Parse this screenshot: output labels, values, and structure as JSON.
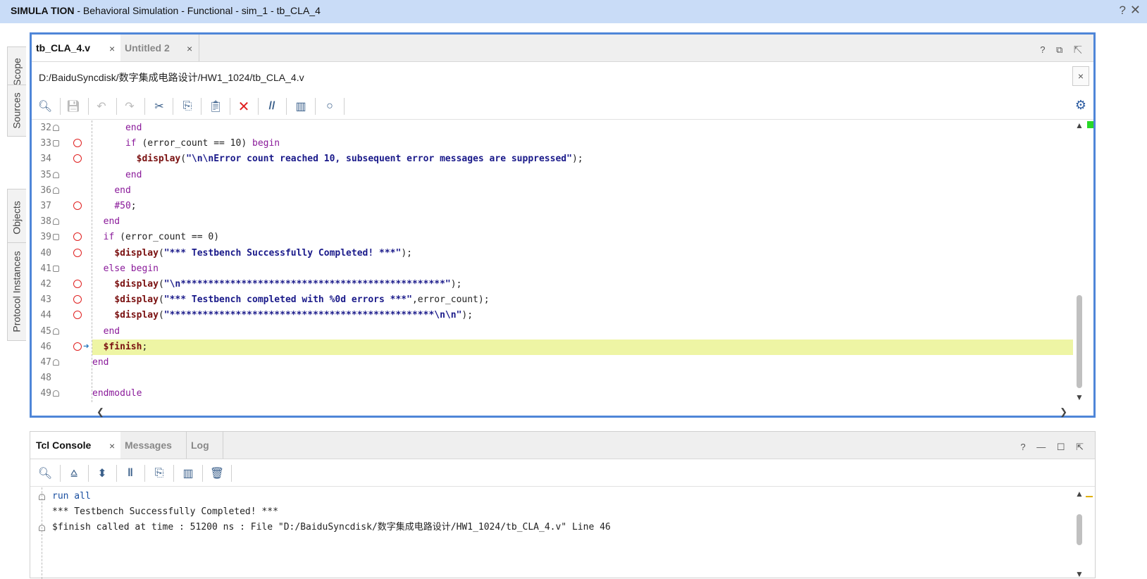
{
  "window": {
    "title_bold": "SIMULA TION",
    "title_rest": " - Behavioral Simulation - Functional - sim_1 - tb_CLA_4",
    "help": "?",
    "close": "✕"
  },
  "side_tabs": [
    "Scope",
    "Sources",
    "Objects",
    "Protocol Instances"
  ],
  "editor": {
    "tabs": [
      {
        "label": "tb_CLA_4.v",
        "close": "×",
        "active": true
      },
      {
        "label": "Untitled 2",
        "close": "×",
        "active": false
      }
    ],
    "window_icons": "? ⧉ ⇱",
    "path": "D:/BaiduSyncdisk/数字集成电路设计/HW1_1024/tb_CLA_4.v",
    "path_close": "×",
    "toolbar_icons": [
      "search-icon",
      "save-icon",
      "undo-icon",
      "redo-icon",
      "cut-icon",
      "copy-icon",
      "paste-icon",
      "delete-icon",
      "comment-icon",
      "columns-icon",
      "bulb-icon"
    ],
    "settings_icon": "gear-icon",
    "lines": [
      {
        "n": "32",
        "fold": "end",
        "bp": false,
        "text_html": "      <span class='kw'>end</span>"
      },
      {
        "n": "33",
        "fold": "start",
        "bp": true,
        "text_html": "      <span class='kw'>if</span> (error_count == 10) <span class='kw'>begin</span>"
      },
      {
        "n": "34",
        "fold": "",
        "bp": true,
        "text_html": "        <span class='sys'>$display</span>(<span class='str'>\"\\n\\nError count reached 10, subsequent error messages are suppressed\"</span>);"
      },
      {
        "n": "35",
        "fold": "end",
        "bp": false,
        "text_html": "      <span class='kw'>end</span>"
      },
      {
        "n": "36",
        "fold": "end",
        "bp": false,
        "text_html": "    <span class='kw'>end</span>"
      },
      {
        "n": "37",
        "fold": "",
        "bp": true,
        "text_html": "    <span class='kw'>#50</span>;"
      },
      {
        "n": "38",
        "fold": "end",
        "bp": false,
        "text_html": "  <span class='kw'>end</span>"
      },
      {
        "n": "39",
        "fold": "start",
        "bp": true,
        "text_html": "  <span class='kw'>if</span> (error_count == 0)"
      },
      {
        "n": "40",
        "fold": "",
        "bp": true,
        "text_html": "    <span class='sys'>$display</span>(<span class='str'>\"*** Testbench Successfully Completed! ***\"</span>);"
      },
      {
        "n": "41",
        "fold": "start",
        "bp": false,
        "text_html": "  <span class='kw'>else begin</span>"
      },
      {
        "n": "42",
        "fold": "",
        "bp": true,
        "text_html": "    <span class='sys'>$display</span>(<span class='str'>\"\\n************************************************\"</span>);"
      },
      {
        "n": "43",
        "fold": "",
        "bp": true,
        "text_html": "    <span class='sys'>$display</span>(<span class='str'>\"*** Testbench completed with %0d errors ***\"</span>,error_count);"
      },
      {
        "n": "44",
        "fold": "",
        "bp": true,
        "text_html": "    <span class='sys'>$display</span>(<span class='str'>\"************************************************\\n\\n\"</span>);"
      },
      {
        "n": "45",
        "fold": "end",
        "bp": false,
        "text_html": "  <span class='kw'>end</span>"
      },
      {
        "n": "46",
        "fold": "",
        "bp": true,
        "current": true,
        "text_html": "  <span class='sys'>$finish</span>;"
      },
      {
        "n": "47",
        "fold": "end",
        "bp": false,
        "text_html": "<span class='kw'>end</span>"
      },
      {
        "n": "48",
        "fold": "",
        "bp": false,
        "text_html": ""
      },
      {
        "n": "49",
        "fold": "end",
        "bp": false,
        "text_html": "<span class='kw'>endmodule</span>"
      }
    ]
  },
  "console": {
    "tabs": [
      {
        "label": "Tcl Console",
        "close": "×",
        "active": true
      },
      {
        "label": "Messages",
        "active": false
      },
      {
        "label": "Log",
        "active": false
      }
    ],
    "window_icons": "? — ☐ ⇱",
    "toolbar_icons": [
      "search-icon",
      "collapse-all-icon",
      "expand-all-icon",
      "pause-icon",
      "copy-icon",
      "columns-icon",
      "trash-icon"
    ],
    "lines": [
      {
        "text": "run all",
        "cmd": true,
        "fold": true
      },
      {
        "text": "*** Testbench Successfully Completed! ***",
        "cmd": false,
        "fold": false
      },
      {
        "text": "$finish called at time : 51200 ns : File \"D:/BaiduSyncdisk/数字集成电路设计/HW1_1024/tb_CLA_4.v\" Line 46",
        "cmd": false,
        "fold": true
      }
    ]
  }
}
